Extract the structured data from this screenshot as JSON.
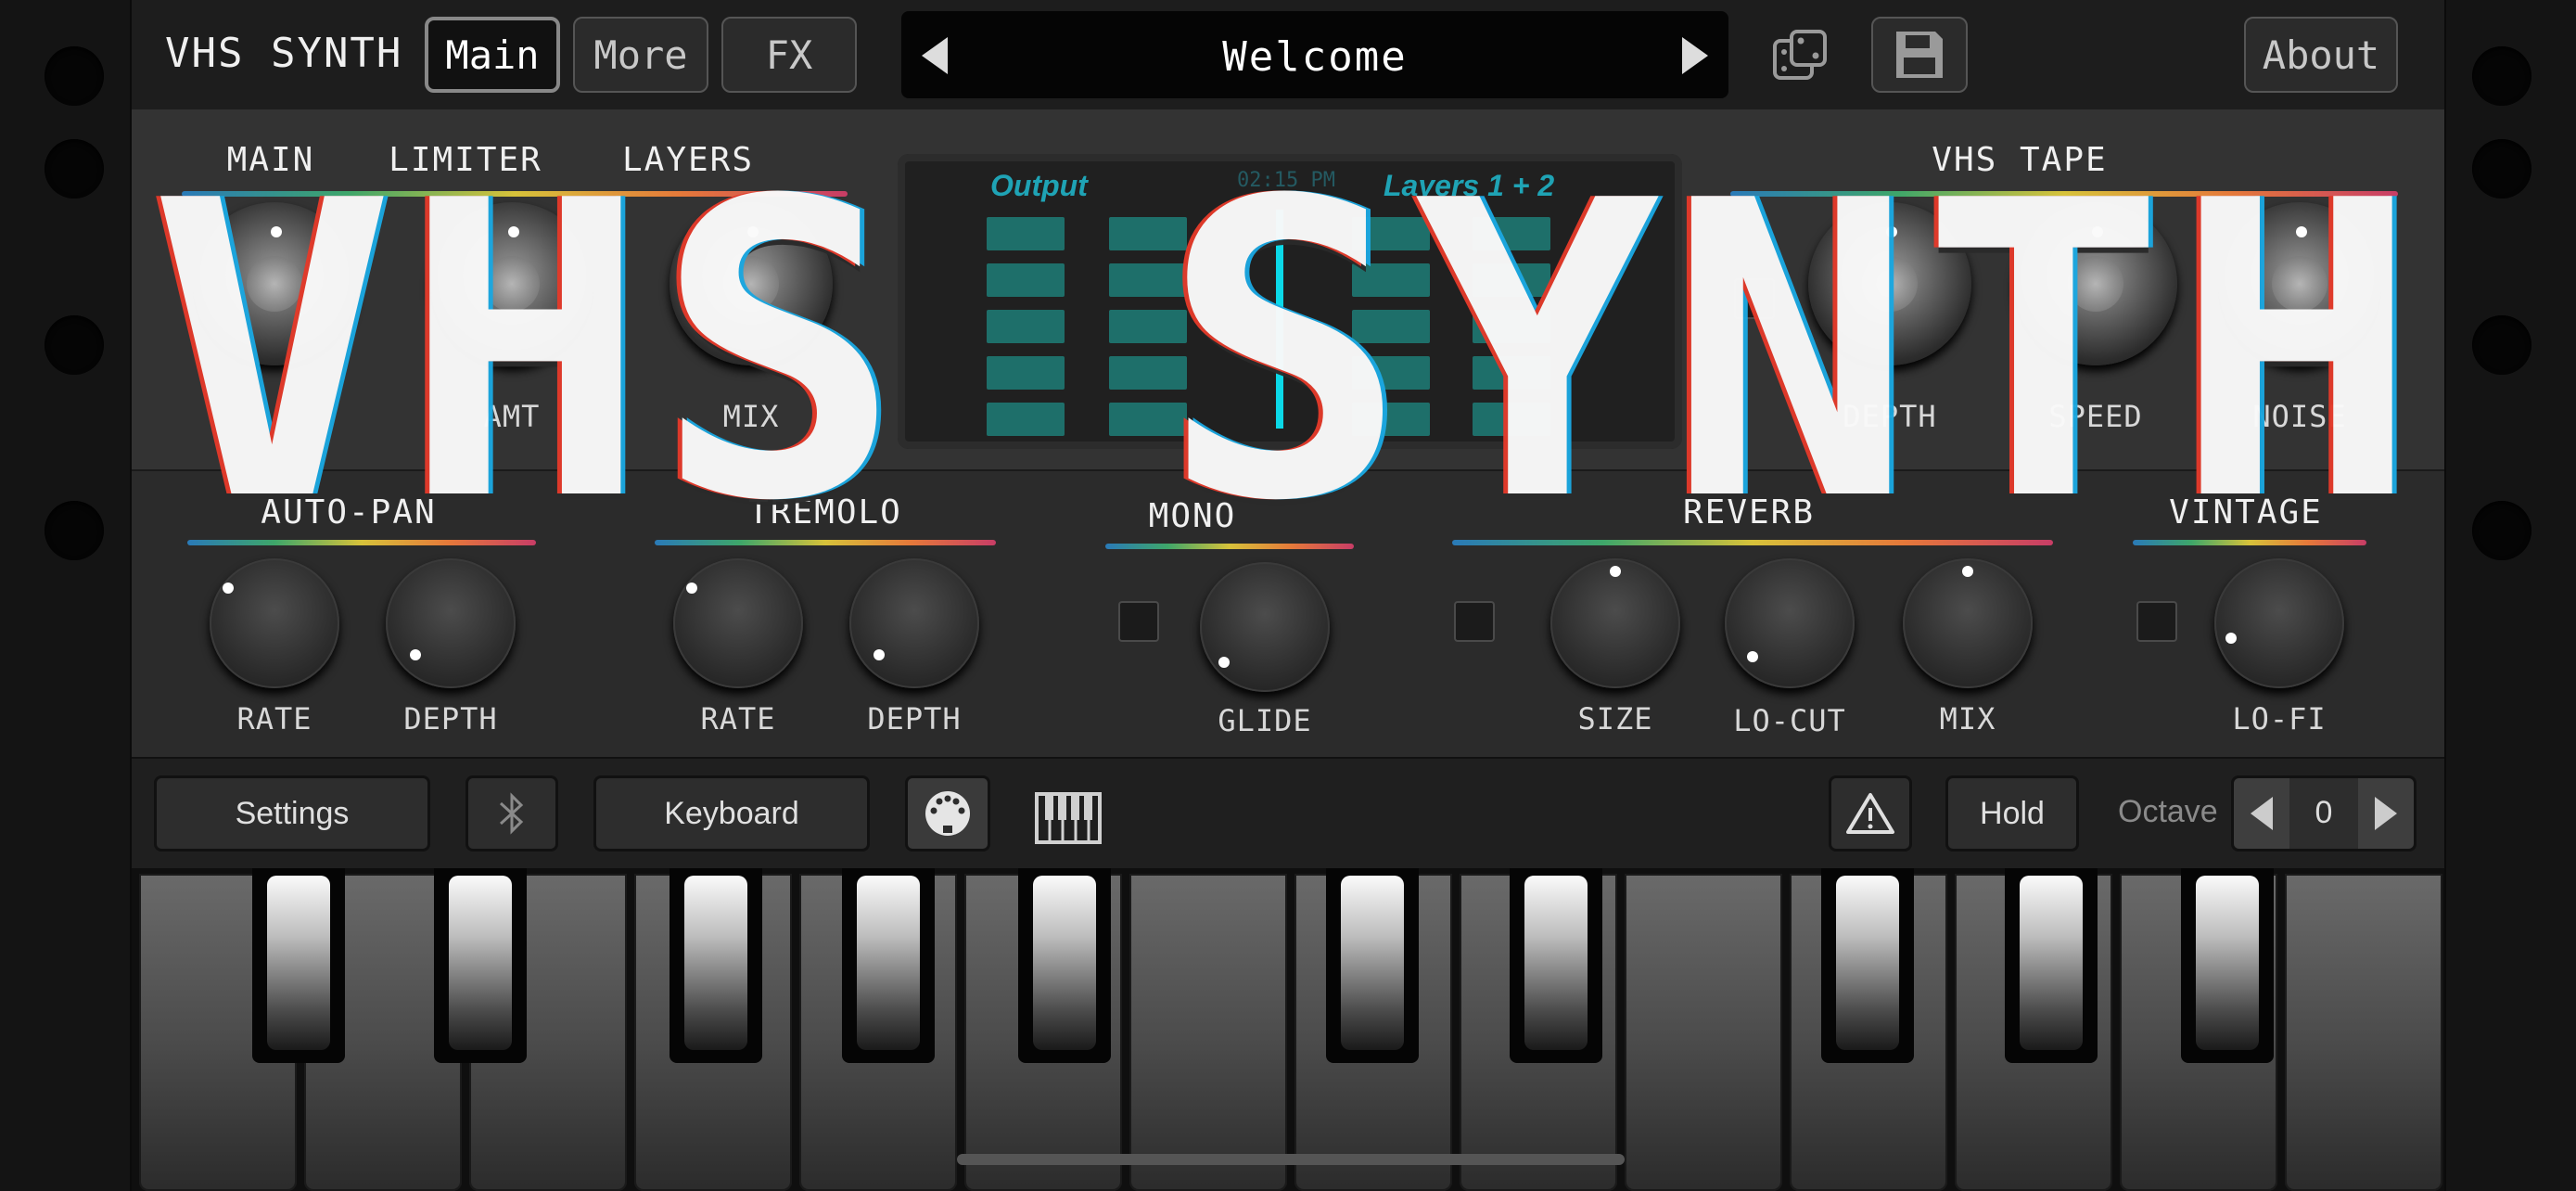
{
  "app": {
    "title": "VHS SYNTH",
    "logo_text": "VHS SYNTH"
  },
  "topbar": {
    "tabs": [
      {
        "label": "Main",
        "active": true
      },
      {
        "label": "More",
        "active": false
      },
      {
        "label": "FX",
        "active": false
      }
    ],
    "preset_name": "Welcome",
    "about_label": "About"
  },
  "section_top": {
    "main_label": "MAIN",
    "limiter_label": "LIMITER",
    "layers_label": "LAYERS",
    "vhs_tape_label": "VHS TAPE",
    "knob_labels": {
      "limiter_amt": "AMT",
      "layers_mix": "MIX",
      "vhs_depth": "DEPTH",
      "vhs_speed": "SPEED",
      "vhs_noise": "NOISE"
    },
    "display": {
      "output_label": "Output",
      "layers_label": "Layers 1 + 2",
      "clock": "02:15 PM"
    }
  },
  "section_fx": {
    "autopan": {
      "title": "AUTO-PAN",
      "rate": "RATE",
      "depth": "DEPTH"
    },
    "tremolo": {
      "title": "TREMOLO",
      "rate": "RATE",
      "depth": "DEPTH"
    },
    "mono": {
      "title": "MONO",
      "glide": "GLIDE"
    },
    "reverb": {
      "title": "REVERB",
      "size": "SIZE",
      "locut": "LO-CUT",
      "mix": "MIX"
    },
    "vintage": {
      "title": "VINTAGE",
      "lofi": "LO-FI"
    }
  },
  "toolbar": {
    "settings_label": "Settings",
    "keyboard_label": "Keyboard",
    "hold_label": "Hold",
    "octave_label": "Octave",
    "octave_value": "0"
  },
  "colors": {
    "accent_teal": "#1fa3b5",
    "meter": "#1e6f6a",
    "playhead": "#0bd9e8"
  }
}
